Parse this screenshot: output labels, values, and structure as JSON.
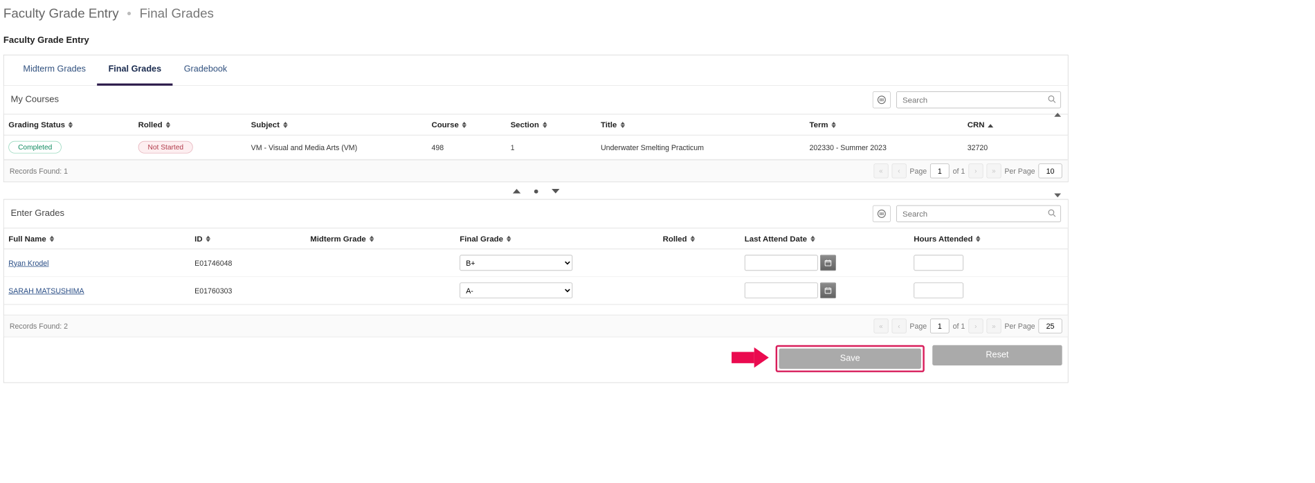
{
  "breadcrumb": {
    "root": "Faculty Grade Entry",
    "current": "Final Grades"
  },
  "section_title": "Faculty Grade Entry",
  "tabs": {
    "midterm": "Midterm Grades",
    "final": "Final Grades",
    "gradebook": "Gradebook"
  },
  "courses": {
    "title": "My Courses",
    "search_placeholder": "Search",
    "headers": {
      "grading_status": "Grading Status",
      "rolled": "Rolled",
      "subject": "Subject",
      "course": "Course",
      "section": "Section",
      "title_col": "Title",
      "term": "Term",
      "crn": "CRN"
    },
    "rows": [
      {
        "grading_status": "Completed",
        "rolled": "Not Started",
        "subject": "VM - Visual and Media Arts (VM)",
        "course": "498",
        "section": "1",
        "title": "Underwater Smelting Practicum",
        "term": "202330 - Summer 2023",
        "crn": "32720"
      }
    ],
    "footer": {
      "records_label": "Records Found: 1",
      "page_label": "Page",
      "page_value": "1",
      "of_label": "of 1",
      "per_page_label": "Per Page",
      "per_page_value": "10"
    }
  },
  "grades": {
    "title": "Enter Grades",
    "search_placeholder": "Search",
    "headers": {
      "full_name": "Full Name",
      "id": "ID",
      "midterm": "Midterm Grade",
      "final": "Final Grade",
      "rolled": "Rolled",
      "last_attend": "Last Attend Date",
      "hours": "Hours Attended"
    },
    "rows": [
      {
        "full_name": "Ryan Krodel",
        "id": "E01746048",
        "final": "B+",
        "last_attend": "",
        "hours": ""
      },
      {
        "full_name": "SARAH MATSUSHIMA",
        "id": "E01760303",
        "final": "A-",
        "last_attend": "",
        "hours": ""
      }
    ],
    "footer": {
      "records_label": "Records Found: 2",
      "page_label": "Page",
      "page_value": "1",
      "of_label": "of 1",
      "per_page_label": "Per Page",
      "per_page_value": "25"
    }
  },
  "actions": {
    "save": "Save",
    "reset": "Reset"
  }
}
